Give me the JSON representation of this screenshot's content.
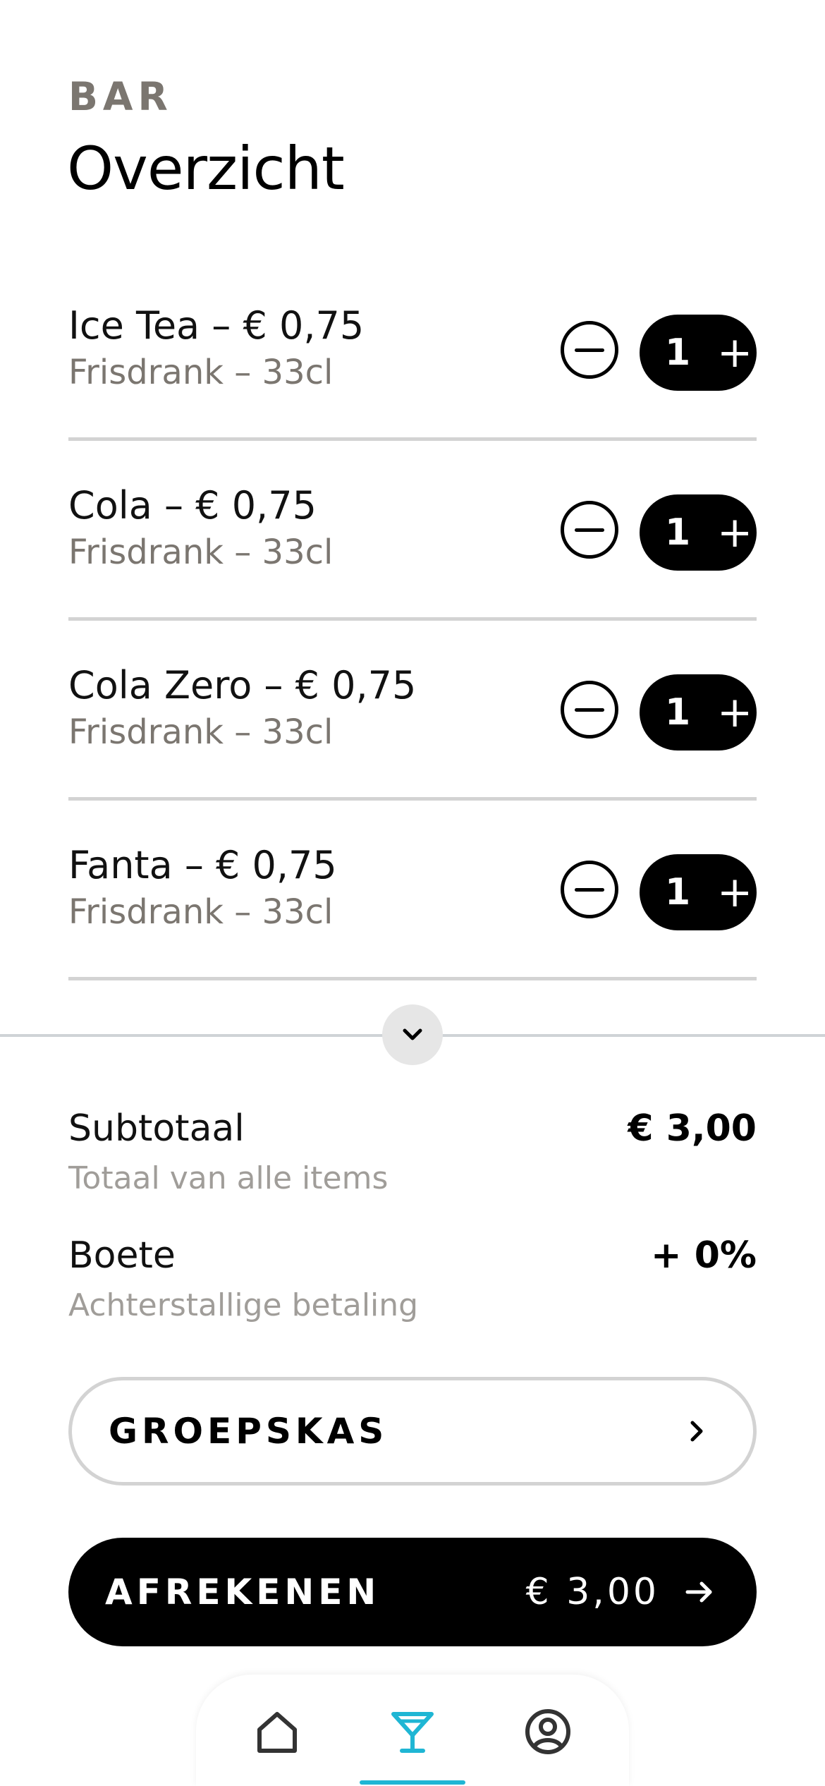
{
  "header": {
    "eyebrow": "BAR",
    "title": "Overzicht"
  },
  "items": [
    {
      "name": "Ice Tea – € 0,75",
      "subtitle": "Frisdrank – 33cl",
      "quantity": "1"
    },
    {
      "name": "Cola – € 0,75",
      "subtitle": "Frisdrank – 33cl",
      "quantity": "1"
    },
    {
      "name": "Cola Zero – € 0,75",
      "subtitle": "Frisdrank – 33cl",
      "quantity": "1"
    },
    {
      "name": "Fanta – € 0,75",
      "subtitle": "Frisdrank – 33cl",
      "quantity": "1"
    }
  ],
  "summary": {
    "subtotal_label": "Subtotaal",
    "subtotal_sub": "Totaal van alle items",
    "subtotal_value": "€ 3,00",
    "fine_label": "Boete",
    "fine_sub": "Achterstallige betaling",
    "fine_value": "+ 0%"
  },
  "actions": {
    "group_label": "GROEPSKAS",
    "pay_label": "AFREKENEN",
    "pay_amount": "€ 3,00"
  },
  "nav": {
    "active": "bar",
    "active_color": "#1fb6d4",
    "icons": [
      "home-icon",
      "cocktail-icon",
      "profile-icon"
    ]
  }
}
